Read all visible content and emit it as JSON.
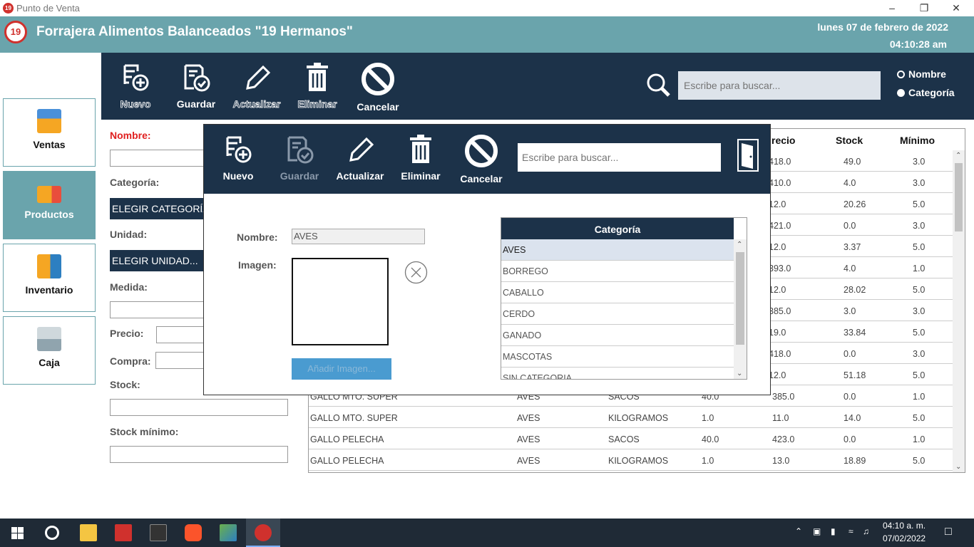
{
  "window": {
    "title": "Punto de Venta"
  },
  "header": {
    "brand": "Forrajera Alimentos Balanceados \"19 Hermanos\"",
    "date": "lunes 07 de febrero de 2022",
    "time": "04:10:28 am",
    "logo_text": "19"
  },
  "toolbar": {
    "buttons": [
      "Nuevo",
      "Guardar",
      "Actualizar",
      "Eliminar",
      "Cancelar"
    ],
    "search_placeholder": "Escribe para buscar...",
    "radio_nombre": "Nombre",
    "radio_categoria": "Categoría",
    "selected_radio": "Categoría"
  },
  "sidebar": {
    "items": [
      "Ventas",
      "Productos",
      "Inventario",
      "Caja"
    ],
    "active": "Productos"
  },
  "form": {
    "nombre": "Nombre:",
    "categoria": "Categoría:",
    "categoria_value": "ELEGIR CATEGORÍA",
    "unidad": "Unidad:",
    "unidad_value": "ELEGIR UNIDAD...",
    "medida": "Medida:",
    "precio": "Precio:",
    "compra": "Compra:",
    "stock": "Stock:",
    "stock_minimo": "Stock mínimo:"
  },
  "table": {
    "headers": [
      "recio",
      "Stock",
      "Mínimo"
    ],
    "rows": [
      {
        "precio": "418.0",
        "stock": "49.0",
        "minimo": "3.0"
      },
      {
        "precio": "410.0",
        "stock": "4.0",
        "minimo": "3.0"
      },
      {
        "precio": "12.0",
        "stock": "20.26",
        "minimo": "5.0"
      },
      {
        "precio": "421.0",
        "stock": "0.0",
        "minimo": "3.0"
      },
      {
        "precio": "12.0",
        "stock": "3.37",
        "minimo": "5.0"
      },
      {
        "precio": "393.0",
        "stock": "4.0",
        "minimo": "1.0"
      },
      {
        "precio": "12.0",
        "stock": "28.02",
        "minimo": "5.0"
      },
      {
        "precio": "385.0",
        "stock": "3.0",
        "minimo": "3.0"
      },
      {
        "precio": "19.0",
        "stock": "33.84",
        "minimo": "5.0"
      },
      {
        "precio": "418.0",
        "stock": "0.0",
        "minimo": "3.0"
      },
      {
        "precio": "12.0",
        "stock": "51.18",
        "minimo": "5.0"
      }
    ],
    "full_rows": [
      {
        "nombre": "GALLO MTO. SUPER",
        "categoria": "AVES",
        "unidad": "SACOS",
        "medida": "40.0",
        "precio": "385.0",
        "stock": "0.0",
        "minimo": "1.0"
      },
      {
        "nombre": "GALLO MTO. SUPER",
        "categoria": "AVES",
        "unidad": "KILOGRAMOS",
        "medida": "1.0",
        "precio": "11.0",
        "stock": "14.0",
        "minimo": "5.0"
      },
      {
        "nombre": "GALLO PELECHA",
        "categoria": "AVES",
        "unidad": "SACOS",
        "medida": "40.0",
        "precio": "423.0",
        "stock": "0.0",
        "minimo": "1.0"
      },
      {
        "nombre": "GALLO PELECHA",
        "categoria": "AVES",
        "unidad": "KILOGRAMOS",
        "medida": "1.0",
        "precio": "13.0",
        "stock": "18.89",
        "minimo": "5.0"
      }
    ]
  },
  "modal": {
    "buttons": [
      "Nuevo",
      "Guardar",
      "Actualizar",
      "Eliminar",
      "Cancelar"
    ],
    "search_placeholder": "Escribe para buscar...",
    "nombre_label": "Nombre:",
    "nombre_value": "AVES",
    "imagen_label": "Imagen:",
    "add_image": "Añadir Imagen...",
    "cat_header": "Categoría",
    "categories": [
      "AVES",
      "BORREGO",
      "CABALLO",
      "CERDO",
      "GANADO",
      "MASCOTAS",
      "SIN CATEGORIA"
    ],
    "selected_category": "AVES"
  },
  "taskbar": {
    "time": "04:10 a. m.",
    "date": "07/02/2022"
  },
  "colors": {
    "header": "#6aa4ac",
    "toolbar": "#1c3249",
    "accent_red": "#d0312d"
  }
}
